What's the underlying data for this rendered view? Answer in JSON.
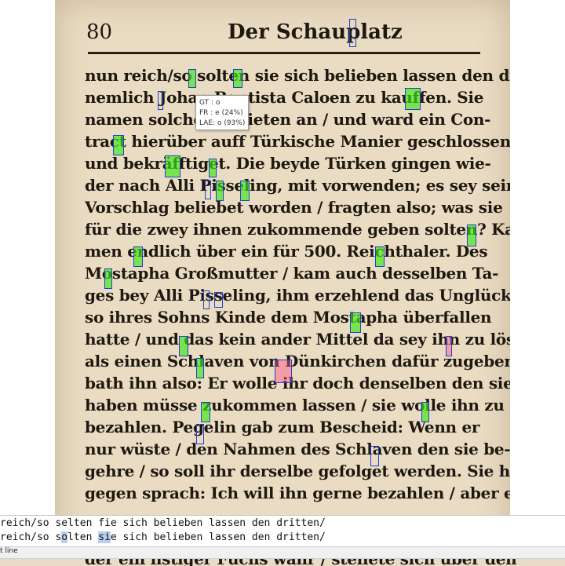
{
  "page": {
    "number": "80",
    "title": "Der Schauplatz",
    "lines": [
      "nun reich/so solten sie sich belieben lassen den dritten/",
      "nemlich Johan Baptista Caloen zu kauffen. Sie",
      "namen solches Erbieten an / und ward ein Con-",
      "tract hierüber auff Türkische Manier geschlossen/",
      "und bekräfftiget. Die beyde Türken gingen wie-",
      "der nach Alli Pisseling, mit vorwenden; es sey sein",
      "Vorschlag beliebet worden / fragten also; was sie",
      "für die zwey ihnen zukommende geben solten? Kah-",
      "men endlich über ein für 500. Reichthaler. Des",
      "Mostapha Großmutter / kam auch desselben Ta-",
      "ges bey Alli Pisseling, ihm erzehlend das Unglück/",
      "so ihres Sohns Kinde dem Mostapha überfallen",
      "hatte / und das kein ander Mittel da sey ihn zu lösen/",
      "als einen Schlaven von Dünkirchen dafür zugeben;",
      "bath ihn also: Er wolle ihr doch denselben den sie",
      "haben müsse zukommen lassen / sie wolle ihn zu Dank",
      "bezahlen. Pegelin gab zum Bescheid: Wenn er",
      "nur wüste / den Nahmen des Schlaven den sie be-",
      "gehre / so soll ihr derselbe gefolget werden. Sie hin-",
      "gegen sprach: Ich will ihn gerne bezahlen / aber es"
    ],
    "bottom_line": "der ein listiger Fuchs wahr / stellete sich über den"
  },
  "tooltip": {
    "gt": "GT : o",
    "fr": "FR : e (24%)",
    "lae": "LAE: o (93%)"
  },
  "compare": {
    "line1_prefix": "reich/so selten fie sich belieben lassen den dritten/",
    "line2_a": "reich/so s",
    "line2_b": "o",
    "line2_c": "lten ",
    "line2_d": "si",
    "line2_e": "e sich belieben lassen den dritten/"
  },
  "status": {
    "text": "t line"
  },
  "colors": {
    "match": "#3ce614",
    "mismatch": "#ff5082",
    "box": "#2040d0",
    "paper": "#e9dcc3"
  }
}
